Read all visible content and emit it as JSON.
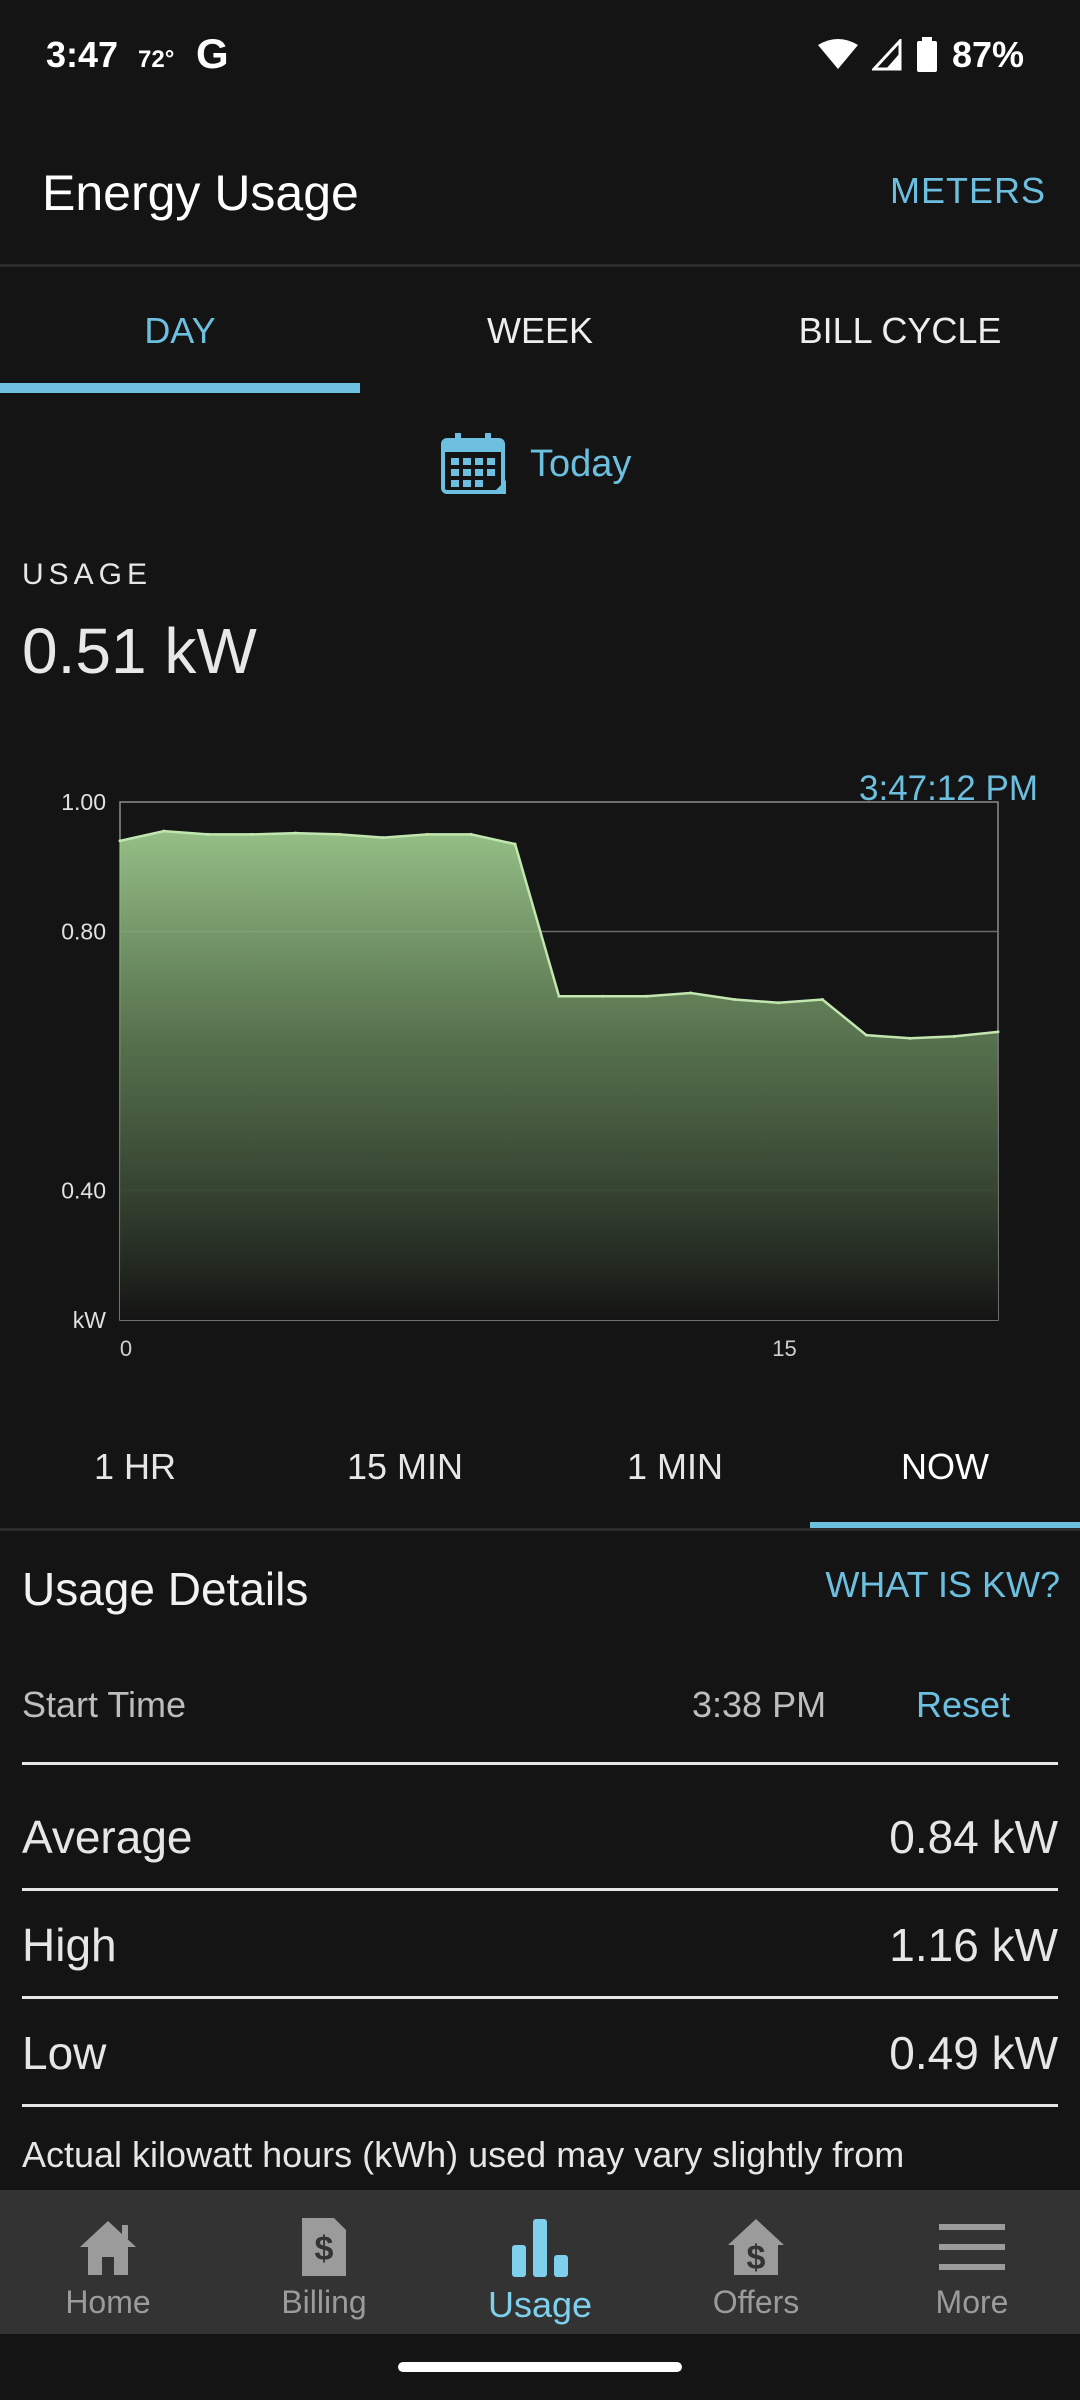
{
  "status_bar": {
    "time": "3:47",
    "temperature": "72°",
    "google_glyph": "G",
    "battery": "87%",
    "icons": [
      "wifi-icon",
      "cell-signal-icon",
      "battery-icon"
    ]
  },
  "app_bar": {
    "title": "Energy Usage",
    "meters_label": "METERS"
  },
  "tabs": [
    {
      "label": "DAY",
      "active": true
    },
    {
      "label": "WEEK",
      "active": false
    },
    {
      "label": "BILL CYCLE",
      "active": false
    }
  ],
  "date_picker": {
    "label": "Today",
    "icon": "calendar-icon"
  },
  "usage": {
    "label": "USAGE",
    "value": "0.51 kW"
  },
  "chart_data": {
    "type": "area",
    "title": "",
    "xlabel": "",
    "ylabel": "kW",
    "timestamp": "3:47:12 PM",
    "y_ticks": [
      "1.00",
      "0.80",
      "0.40"
    ],
    "x_ticks": [
      {
        "label": "0",
        "x": 0
      },
      {
        "label": "15",
        "x": 15
      }
    ],
    "xlim": [
      0,
      20
    ],
    "ylim": [
      0.2,
      1.0
    ],
    "grid": true,
    "x": [
      0,
      1,
      2,
      3,
      4,
      5,
      6,
      7,
      8,
      9,
      10,
      11,
      12,
      13,
      14,
      15,
      16,
      17,
      18,
      19,
      20
    ],
    "values": [
      0.94,
      0.955,
      0.95,
      0.95,
      0.952,
      0.95,
      0.945,
      0.95,
      0.95,
      0.935,
      0.7,
      0.7,
      0.7,
      0.705,
      0.695,
      0.69,
      0.695,
      0.64,
      0.635,
      0.638,
      0.645
    ],
    "colors": {
      "line": "#c2e6b0",
      "fill_top": "#9cc88c",
      "fill_bottom": "#141414",
      "grid": "#6a6a6a",
      "axis": "#8c8c8c",
      "timestamp": "#6cbfdf"
    }
  },
  "interval_tabs": [
    {
      "label": "1 HR",
      "active": false
    },
    {
      "label": "15 MIN",
      "active": false
    },
    {
      "label": "1 MIN",
      "active": false
    },
    {
      "label": "NOW",
      "active": true
    }
  ],
  "details": {
    "title": "Usage Details",
    "what_is_label": "WHAT IS KW?",
    "start_time_label": "Start Time",
    "start_time_value": "3:38 PM",
    "reset_label": "Reset",
    "stats": [
      {
        "label": "Average",
        "value": "0.84 kW"
      },
      {
        "label": "High",
        "value": "1.16 kW"
      },
      {
        "label": "Low",
        "value": "0.49 kW"
      }
    ],
    "note": "Actual kilowatt hours (kWh) used may vary slightly from"
  },
  "bottom_nav": [
    {
      "label": "Home",
      "icon": "home-icon",
      "active": false
    },
    {
      "label": "Billing",
      "icon": "bill-icon",
      "active": false
    },
    {
      "label": "Usage",
      "icon": "bar-chart-icon",
      "active": true
    },
    {
      "label": "Offers",
      "icon": "offers-icon",
      "active": false
    },
    {
      "label": "More",
      "icon": "menu-icon",
      "active": false
    }
  ],
  "colors": {
    "accent": "#6cbfdf",
    "background": "#141414",
    "nav_background": "#333333"
  }
}
